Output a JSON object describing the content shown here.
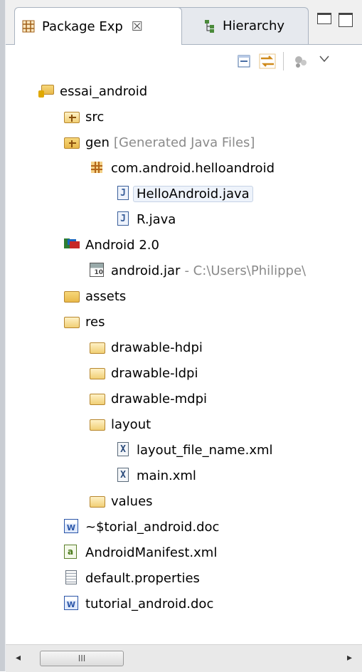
{
  "tabs": {
    "active": {
      "label": "Package Exp",
      "close": "☒"
    },
    "inactive": {
      "label": "Hierarchy"
    }
  },
  "tree": [
    {
      "id": "essai",
      "label": "essai_android",
      "icon": "project-icon"
    },
    {
      "id": "src",
      "label": "src",
      "icon": "source-folder-icon"
    },
    {
      "id": "gen",
      "label": "gen",
      "decoration": "[Generated Java Files]",
      "icon": "source-folder-icon"
    },
    {
      "id": "pkg",
      "label": "com.android.helloandroid",
      "icon": "package-icon"
    },
    {
      "id": "hello",
      "label": "HelloAndroid.java",
      "icon": "java-file-icon"
    },
    {
      "id": "r",
      "label": "R.java",
      "icon": "java-file-icon"
    },
    {
      "id": "android20",
      "label": "Android 2.0",
      "icon": "library-icon"
    },
    {
      "id": "jar",
      "label": "android.jar",
      "decoration": "- C:\\Users\\Philippe\\",
      "icon": "jar-icon"
    },
    {
      "id": "assets",
      "label": "assets",
      "icon": "folder-icon"
    },
    {
      "id": "res",
      "label": "res",
      "icon": "folder-icon"
    },
    {
      "id": "dhdpi",
      "label": "drawable-hdpi",
      "icon": "folder-icon"
    },
    {
      "id": "dldpi",
      "label": "drawable-ldpi",
      "icon": "folder-icon"
    },
    {
      "id": "dmdpi",
      "label": "drawable-mdpi",
      "icon": "folder-icon"
    },
    {
      "id": "layout",
      "label": "layout",
      "icon": "folder-icon"
    },
    {
      "id": "lfn",
      "label": "layout_file_name.xml",
      "icon": "xml-file-icon"
    },
    {
      "id": "main",
      "label": "main.xml",
      "icon": "xml-file-icon"
    },
    {
      "id": "values",
      "label": "values",
      "icon": "folder-icon"
    },
    {
      "id": "tmpdoc",
      "label": "~$torial_android.doc",
      "icon": "word-doc-icon"
    },
    {
      "id": "manifest",
      "label": "AndroidManifest.xml",
      "icon": "manifest-icon"
    },
    {
      "id": "props",
      "label": "default.properties",
      "icon": "properties-file-icon"
    },
    {
      "id": "tutdoc",
      "label": "tutorial_android.doc",
      "icon": "word-doc-icon"
    }
  ],
  "icons": {
    "java": "J",
    "xml": "X",
    "word": "W",
    "manifest": "a",
    "jar": "10"
  },
  "scrollbar": {
    "left": "◂",
    "right": "▸",
    "grip": "III"
  }
}
